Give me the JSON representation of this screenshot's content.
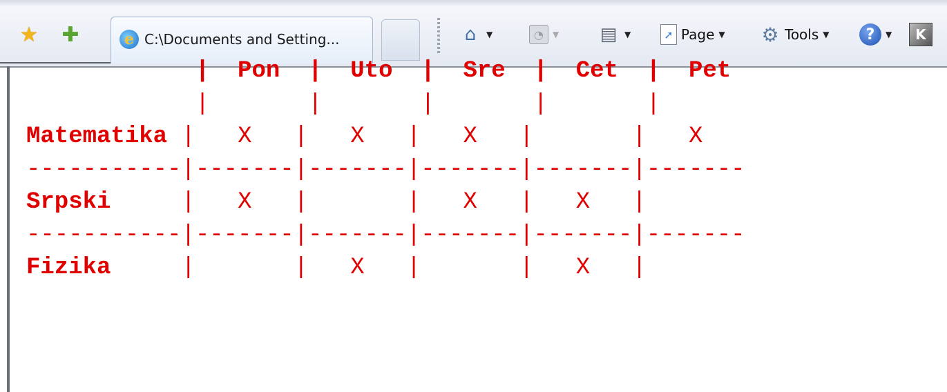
{
  "browser": {
    "tab_title": "C:\\Documents and Setting...",
    "toolbar": {
      "page_label": "Page",
      "tools_label": "Tools"
    },
    "icons": [
      "favorites-star-icon",
      "add-favorite-icon",
      "ie-icon",
      "home-icon",
      "feeds-icon",
      "print-icon",
      "page-icon",
      "tools-gear-icon",
      "help-icon",
      "k-icon"
    ]
  },
  "schedule": {
    "header_row": "            |  Pon  |  Uto  |  Sre  |  Cet  |  Pet",
    "spacer_row": "            |       |       |       |       |",
    "rows": [
      {
        "subject": "Matematika",
        "cells": "|   X   |   X   |   X   |       |   X"
      },
      {
        "subject": "Srpski",
        "cells": "|   X   |       |   X   |   X   |"
      },
      {
        "subject": "Fizika",
        "cells": "|       |   X   |       |   X   |"
      }
    ],
    "separator": "-----------|-------|-------|-------|-------|-------"
  }
}
